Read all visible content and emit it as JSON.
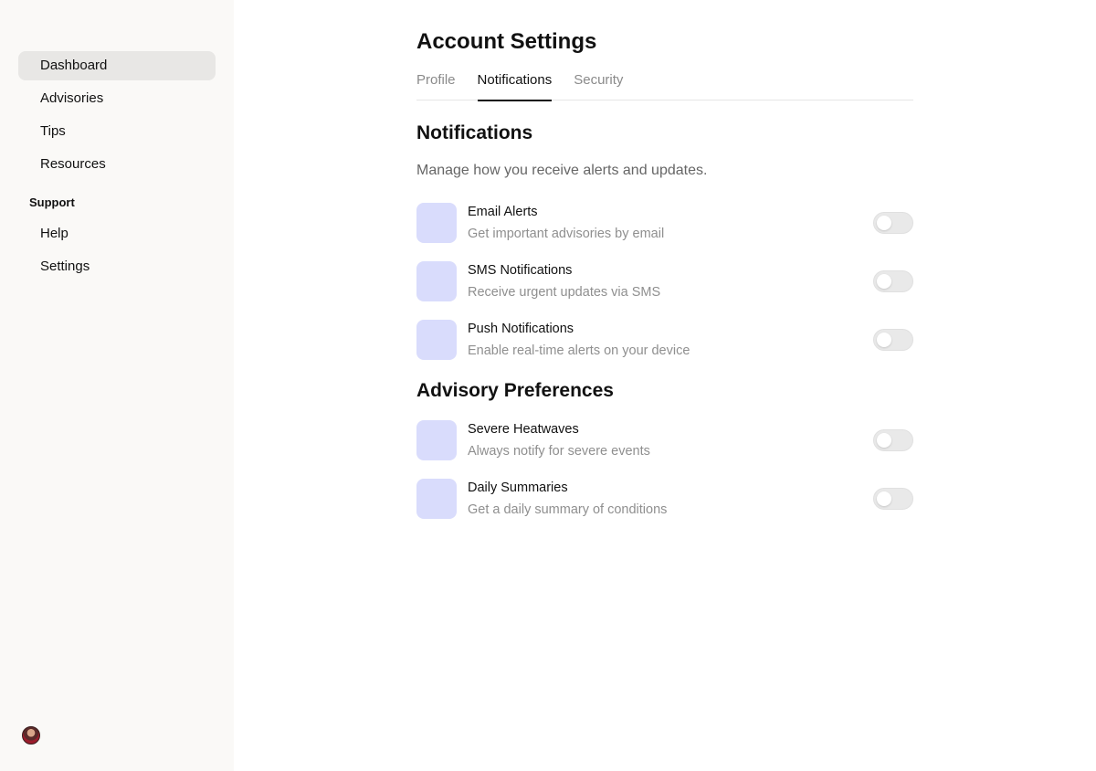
{
  "sidebar": {
    "items": [
      {
        "label": "Dashboard",
        "active": true
      },
      {
        "label": "Advisories"
      },
      {
        "label": "Tips"
      },
      {
        "label": "Resources"
      }
    ],
    "section_label": "Support",
    "support_items": [
      {
        "label": "Help"
      },
      {
        "label": "Settings"
      }
    ]
  },
  "page": {
    "title": "Account Settings",
    "tabs": [
      {
        "label": "Profile"
      },
      {
        "label": "Notifications",
        "active": true
      },
      {
        "label": "Security"
      }
    ]
  },
  "notifications": {
    "title": "Notifications",
    "description": "Manage how you receive alerts and updates.",
    "rows": [
      {
        "title": "Email Alerts",
        "subtitle": "Get important advisories by email",
        "enabled": false
      },
      {
        "title": "SMS Notifications",
        "subtitle": "Receive urgent updates via SMS",
        "enabled": false
      },
      {
        "title": "Push Notifications",
        "subtitle": "Enable real-time alerts on your device",
        "enabled": false
      }
    ]
  },
  "advisory": {
    "title": "Advisory Preferences",
    "rows": [
      {
        "title": "Severe Heatwaves",
        "subtitle": "Always notify for severe events",
        "enabled": false
      },
      {
        "title": "Daily Summaries",
        "subtitle": "Get a daily summary of conditions",
        "enabled": false
      }
    ]
  },
  "colors": {
    "sidebar_bg": "#faf9f7",
    "active_nav_bg": "#e8e7e5",
    "row_icon_bg": "#d9dcfc",
    "toggle_off": "#e9e9e9"
  }
}
